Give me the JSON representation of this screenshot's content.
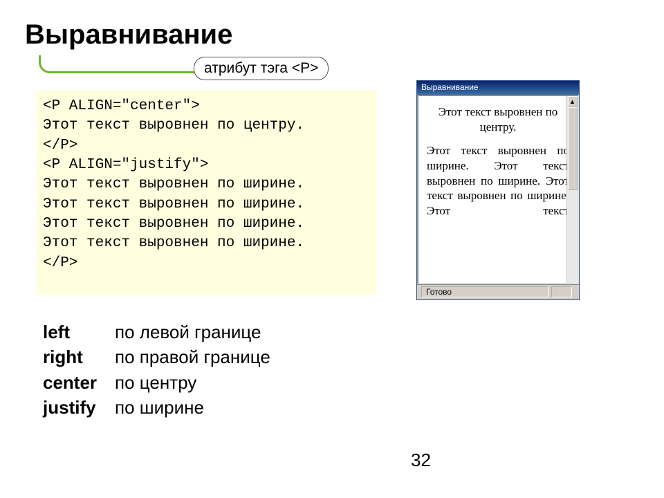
{
  "title": "Выравнивание",
  "badge": "атрибут тэга <P>",
  "code": "<P ALIGN=\"center\">\nЭтот текст выровнен по центру.\n</P>\n<P ALIGN=\"justify\">\nЭтот текст выровнен по ширине.\nЭтот текст выровнен по ширине.\nЭтот текст выровнен по ширине.\nЭтот текст выровнен по ширине.\n</P>",
  "browser": {
    "title": "Выравнивание",
    "centered": "Этот текст выровнен по центру.",
    "justified": "Этот текст выровнен по ширине. Этот текст выровнен по ширине. Этот текст выровнен по ширине. Этот текст",
    "status": "Готово"
  },
  "legend": [
    {
      "key": "left",
      "desc": "по левой границе"
    },
    {
      "key": "right",
      "desc": "по правой границе"
    },
    {
      "key": "center",
      "desc": "по центру"
    },
    {
      "key": "justify",
      "desc": "по ширине"
    }
  ],
  "page": "32"
}
